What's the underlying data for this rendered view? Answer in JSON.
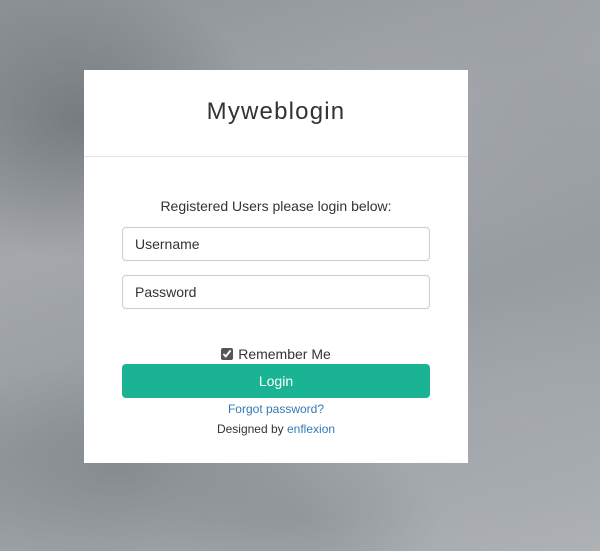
{
  "header": {
    "title": "Myweblogin"
  },
  "form": {
    "intro_text": "Registered Users please login below:",
    "username_placeholder": "Username",
    "password_placeholder": "Password",
    "remember_label": "Remember Me",
    "remember_checked": true,
    "login_label": "Login",
    "forgot_label": "Forgot password?"
  },
  "footer": {
    "designed_by_prefix": "Designed by",
    "designer_name": "enflexion"
  },
  "colors": {
    "accent": "#1ab394",
    "link": "#337ab7"
  }
}
